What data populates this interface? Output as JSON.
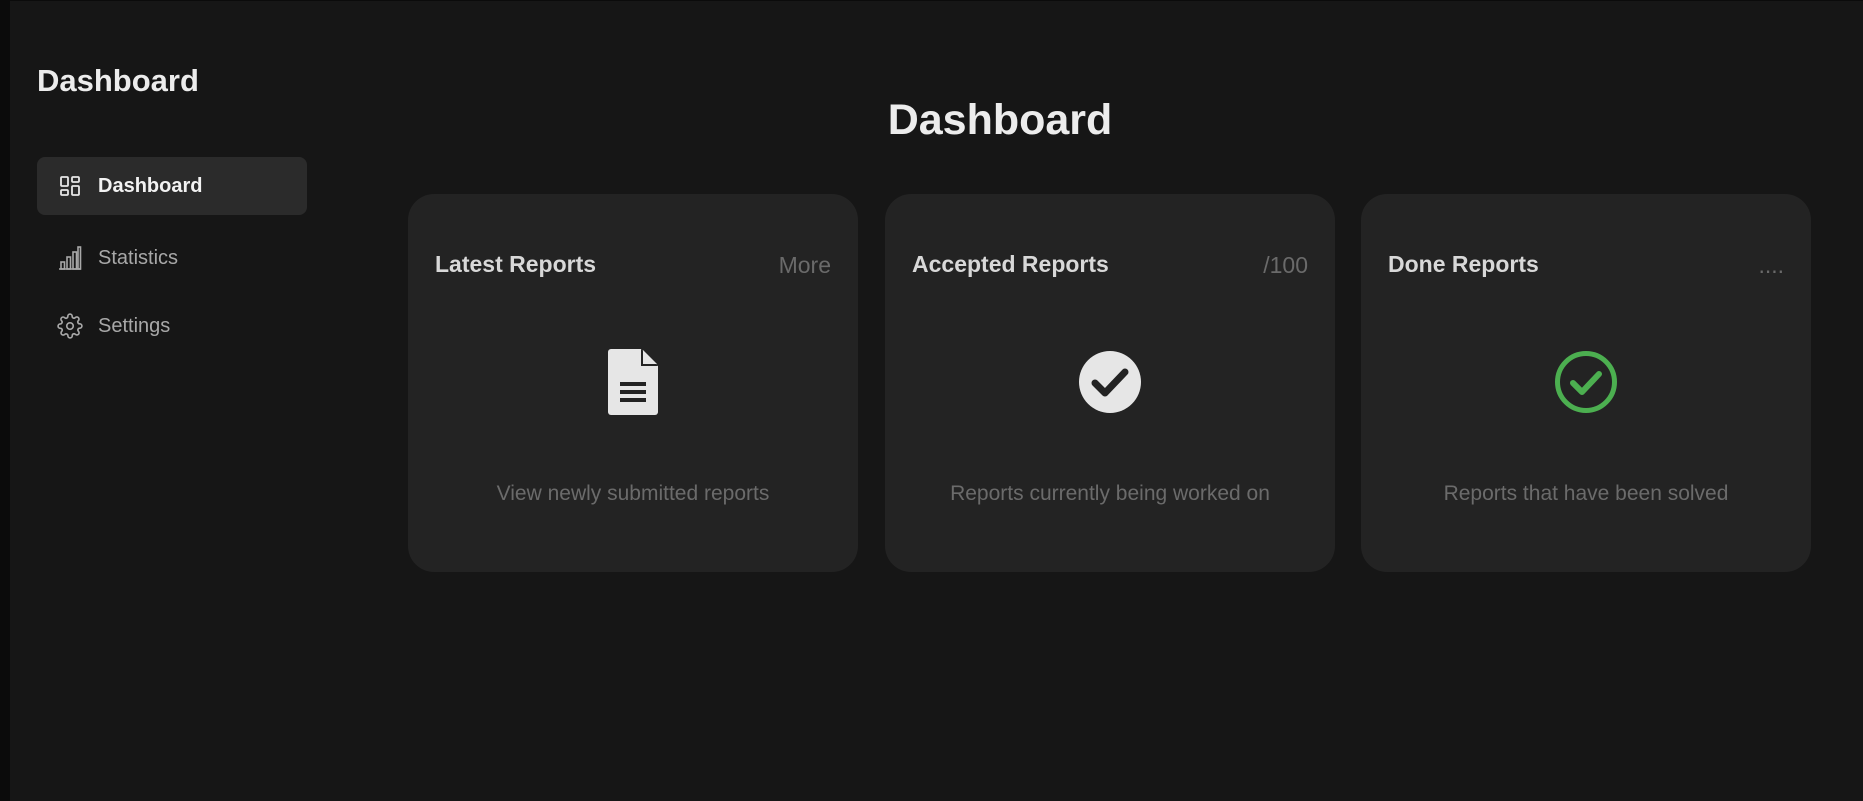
{
  "sidebar": {
    "title": "Dashboard",
    "items": [
      {
        "label": "Dashboard",
        "icon": "dashboard-grid-icon",
        "active": true
      },
      {
        "label": "Statistics",
        "icon": "bar-chart-icon",
        "active": false
      },
      {
        "label": "Settings",
        "icon": "gear-icon",
        "active": false
      }
    ]
  },
  "main": {
    "title": "Dashboard",
    "cards": [
      {
        "title": "Latest Reports",
        "aside": "More",
        "icon": "document-icon",
        "description": "View newly submitted reports"
      },
      {
        "title": "Accepted Reports",
        "aside": "/100",
        "icon": "check-circle-filled-icon",
        "description": "Reports currently being worked on"
      },
      {
        "title": "Done Reports",
        "aside": "....",
        "icon": "check-circle-outline-icon",
        "description": "Reports that have been solved"
      }
    ]
  },
  "colors": {
    "background": "#161616",
    "card": "#232323",
    "active_nav": "#2b2b2b",
    "success": "#4caf50",
    "icon_light": "#e6e6e6"
  }
}
